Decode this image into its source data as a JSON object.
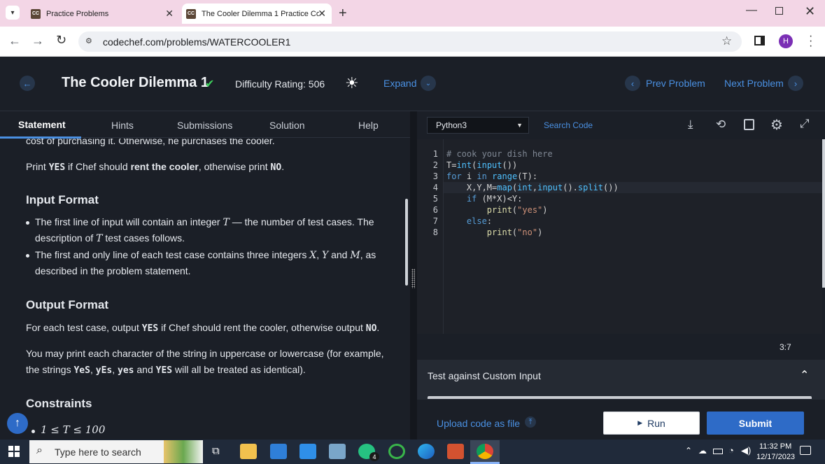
{
  "browser": {
    "tabs": [
      {
        "label": "Practice Problems",
        "favicon": "CC",
        "active": false
      },
      {
        "label": "The Cooler Dilemma 1 Practice Co",
        "favicon": "CC",
        "active": true
      }
    ],
    "url": "codechef.com/problems/WATERCOOLER1",
    "profile_initial": "H"
  },
  "header": {
    "title": "The Cooler Dilemma 1",
    "difficulty": "Difficulty Rating: 506",
    "expand_label": "Expand",
    "prev_label": "Prev Problem",
    "next_label": "Next Problem"
  },
  "problem_tabs": [
    "Statement",
    "Hints",
    "Submissions",
    "Solution",
    "Help"
  ],
  "statement": {
    "clipped_line": "cost of purchasing it. Otherwise, he purchases the cooler.",
    "print_line": {
      "p1": "Print ",
      "yes": "YES",
      "p2": " if Chef should ",
      "rent": "rent the cooler",
      "p3": ", otherwise print ",
      "no": "NO",
      "p4": "."
    },
    "input_heading": "Input Format",
    "input_b1": {
      "a": "The first line of input will contain an integer ",
      "T": "T",
      "b": " — the number of test cases. The"
    },
    "input_b1_cont": {
      "a": "description of ",
      "T": "T",
      "b": " test cases follows."
    },
    "input_b2": {
      "a": "The first and only line of each test case contains three integers ",
      "X": "X",
      "c1": ", ",
      "Y": "Y",
      "and": " and ",
      "M": "M",
      "b": ", as"
    },
    "input_b2_cont": "described in the problem statement.",
    "output_heading": "Output Format",
    "output_line": {
      "a": "For each test case, output ",
      "yes": "YES",
      "b": " if Chef should rent the cooler, otherwise output ",
      "no": "NO",
      "c": "."
    },
    "case_line1": "You may print each character of the string in uppercase or lowercase (for example,",
    "case_line2": {
      "a": "the strings ",
      "v1": "YeS",
      "c1": ", ",
      "v2": "yEs",
      "c2": ", ",
      "v3": "yes",
      "and": " and ",
      "v4": "YES",
      "b": " will all be treated as identical)."
    },
    "constraints_heading": "Constraints",
    "constraint1": "1 ≤ T ≤ 100"
  },
  "editor": {
    "language": "Python3",
    "search_label": "Search Code",
    "line_numbers": [
      "1",
      "2",
      "3",
      "4",
      "5",
      "6",
      "7",
      "8"
    ],
    "cursor": "3:7",
    "custom_input_label": "Test against Custom Input",
    "upload_label": "Upload code as file",
    "run_label": "Run",
    "submit_label": "Submit"
  },
  "taskbar": {
    "search_placeholder": "Type here to search",
    "time": "11:32 PM",
    "date": "12/17/2023",
    "whatsapp_badge": "4"
  },
  "colors": {
    "accent": "#4a90e2",
    "submit_bg": "#2e6bc7",
    "check": "#3ecf5c",
    "tab_active_line": "#4a90e2"
  }
}
